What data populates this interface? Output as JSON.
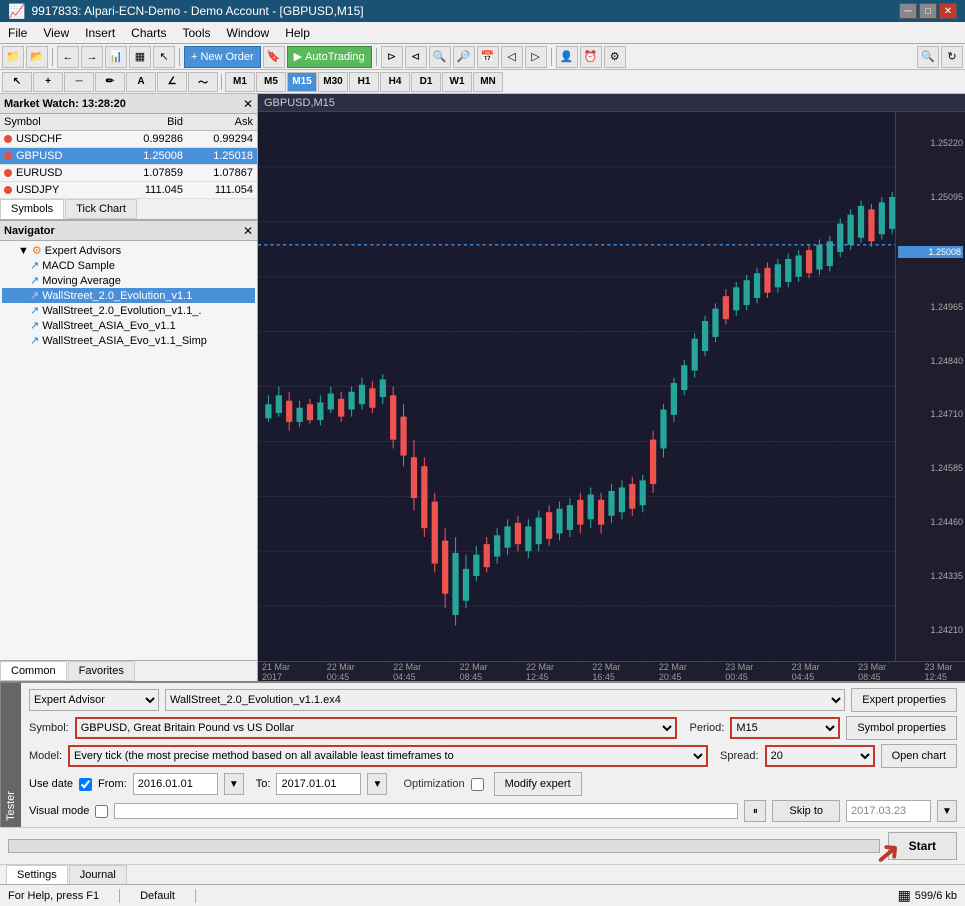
{
  "titleBar": {
    "text": "9917833: Alpari-ECN-Demo - Demo Account - [GBPUSD,M15]",
    "controls": [
      "minimize",
      "restore",
      "close"
    ]
  },
  "menuBar": {
    "items": [
      "File",
      "View",
      "Insert",
      "Charts",
      "Tools",
      "Window",
      "Help"
    ]
  },
  "toolbar1": {
    "newOrderLabel": "New Order",
    "autoTradingLabel": "AutoTrading"
  },
  "toolbar2": {
    "timeframes": [
      "M1",
      "M5",
      "M15",
      "M30",
      "H1",
      "H4",
      "D1",
      "W1",
      "MN"
    ]
  },
  "marketWatch": {
    "title": "Market Watch: 13:28:20",
    "columns": [
      "Symbol",
      "Bid",
      "Ask"
    ],
    "rows": [
      {
        "symbol": "USDCHF",
        "bid": "0.99286",
        "ask": "0.99294",
        "selected": false
      },
      {
        "symbol": "GBPUSD",
        "bid": "1.25008",
        "ask": "1.25018",
        "selected": true
      },
      {
        "symbol": "EURUSD",
        "bid": "1.07859",
        "ask": "1.07867",
        "selected": false
      },
      {
        "symbol": "USDJPY",
        "bid": "111.045",
        "ask": "111.054",
        "selected": false
      }
    ],
    "tabs": [
      "Symbols",
      "Tick Chart"
    ]
  },
  "navigator": {
    "title": "Navigator",
    "tree": [
      {
        "label": "Expert Advisors",
        "level": 1,
        "expanded": true
      },
      {
        "label": "MACD Sample",
        "level": 2
      },
      {
        "label": "Moving Average",
        "level": 2
      },
      {
        "label": "WallStreet_2.0_Evolution_v1.1",
        "level": 2,
        "selected": true
      },
      {
        "label": "WallStreet_2.0_Evolution_v1.1_.",
        "level": 2
      },
      {
        "label": "WallStreet_ASIA_Evo_v1.1",
        "level": 2
      },
      {
        "label": "WallStreet_ASIA_Evo_v1.1_Simp",
        "level": 2
      }
    ],
    "tabs": [
      "Common",
      "Favorites"
    ]
  },
  "chart": {
    "title": "GBPUSD,M15",
    "priceLabels": [
      "1.25220",
      "1.25095",
      "1.25008",
      "1.24965",
      "1.24840",
      "1.24710",
      "1.24585",
      "1.24460",
      "1.24335",
      "1.24210"
    ],
    "currentPrice": "1.25008",
    "timeLabels": [
      "21 Mar 2017",
      "22 Mar 00:45",
      "22 Mar 04:45",
      "22 Mar 08:45",
      "22 Mar 12:45",
      "22 Mar 16:45",
      "22 Mar 20:45",
      "23 Mar 00:45",
      "23 Mar 04:45",
      "23 Mar 08:45",
      "23 Mar 12:45"
    ]
  },
  "tester": {
    "sideLabel": "Tester",
    "expertAdvisorLabel": "Expert Advisor",
    "expertAdvisorValue": "WallStreet_2.0_Evolution_v1.1.ex4",
    "symbolLabel": "Symbol:",
    "symbolValue": "GBPUSD, Great Britain Pound vs US Dollar",
    "periodLabel": "Period:",
    "periodValue": "M15",
    "modelLabel": "Model:",
    "modelValue": "Every tick (the most precise method based on all available least timeframes to",
    "spreadLabel": "Spread:",
    "spreadValue": "20",
    "useDateLabel": "Use date",
    "fromLabel": "From:",
    "fromValue": "2016.01.01",
    "toLabel": "To:",
    "toValue": "2017.01.01",
    "toDateDisplay": "2017.03.23",
    "optimizationLabel": "Optimization",
    "visualModeLabel": "Visual mode",
    "skipToLabel": "Skip to",
    "buttons": {
      "expertProperties": "Expert properties",
      "symbolProperties": "Symbol properties",
      "openChart": "Open chart",
      "modifyExpert": "Modify expert",
      "start": "Start"
    },
    "tabs": [
      "Settings",
      "Journal"
    ]
  },
  "statusBar": {
    "help": "For Help, press F1",
    "default": "Default",
    "memory": "599/6 kb"
  }
}
